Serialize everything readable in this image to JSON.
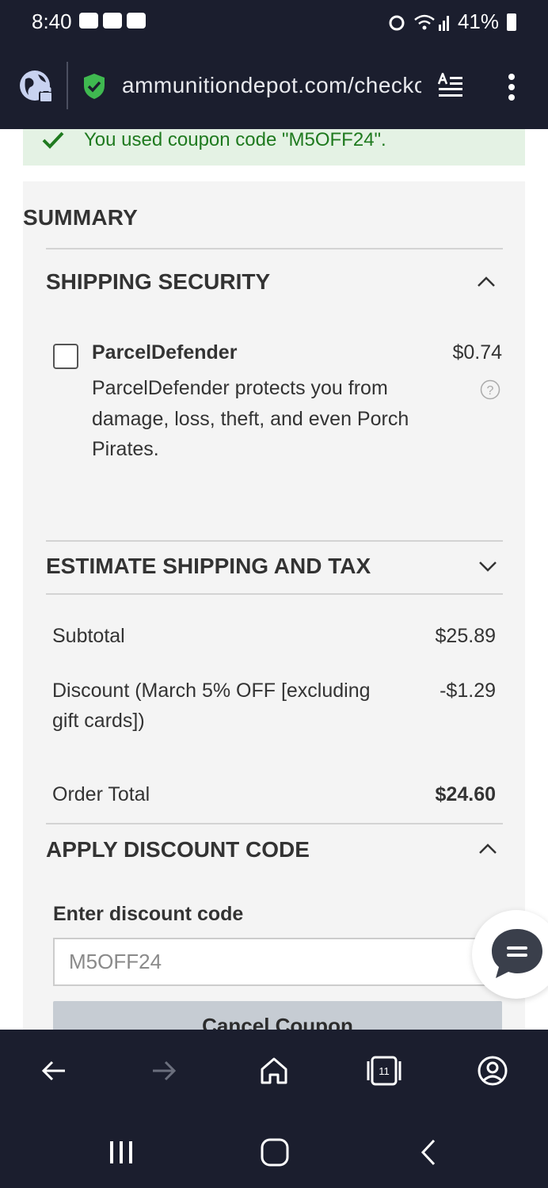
{
  "status_bar": {
    "time": "8:40",
    "battery": "41%"
  },
  "browser": {
    "url": "ammunitiondepot.com/checkout/cart/"
  },
  "coupon_banner": {
    "text": "You used coupon code \"M5OFF24\"."
  },
  "summary": {
    "title": "SUMMARY",
    "shipping_security": {
      "title": "SHIPPING SECURITY",
      "option_name": "ParcelDefender",
      "option_price": "$0.74",
      "option_description": "ParcelDefender protects you from damage, loss, theft, and even Porch Pirates."
    },
    "estimate_title": "ESTIMATE SHIPPING AND TAX",
    "totals": [
      {
        "label": "Subtotal",
        "value": "$25.89"
      },
      {
        "label": "Discount (March 5% OFF [excluding gift cards])",
        "value": "-$1.29"
      },
      {
        "label": "Order Total",
        "value": "$24.60"
      }
    ],
    "discount": {
      "title": "APPLY DISCOUNT CODE",
      "field_label": "Enter discount code",
      "field_value": "M5OFF24",
      "cancel_button": "Cancel Coupon"
    }
  },
  "colors": {
    "chrome_bg": "#1b1e2e",
    "success_green": "#1f7a1f",
    "banner_bg": "#e4f2e4",
    "shield_green": "#3fb950"
  },
  "icons": [
    "globe-lock-icon",
    "shield-check-icon",
    "reader-mode-icon",
    "more-vert-icon",
    "check-icon",
    "chevron-up-icon",
    "chevron-down-icon",
    "help-icon",
    "chat-icon",
    "back-icon",
    "forward-icon",
    "home-icon",
    "tabs-icon",
    "account-icon",
    "recent-apps-icon",
    "home-circle-icon",
    "system-back-icon"
  ],
  "browser_nav": {
    "tab_count": "11"
  }
}
